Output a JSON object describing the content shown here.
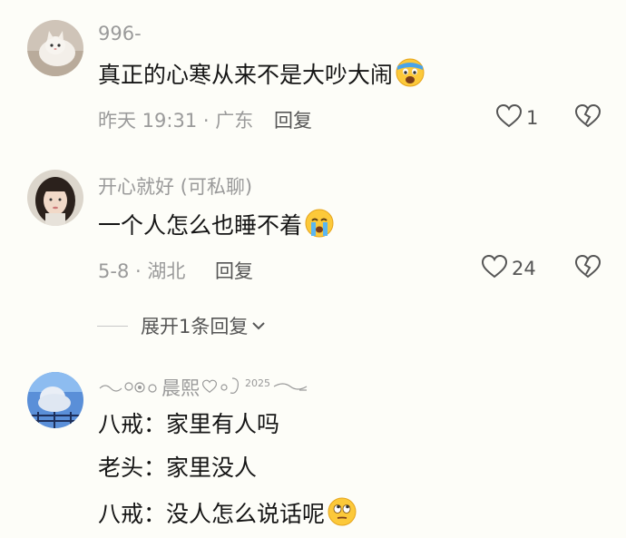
{
  "comments": [
    {
      "username": "996-",
      "text": "真正的心寒从来不是大吵大闹",
      "meta": "昨天 19:31 · 广东",
      "reply_label": "回复",
      "likes": "1",
      "emoji": "worried-face"
    },
    {
      "username": "开心就好 (可私聊)",
      "text": "一个人怎么也睡不着",
      "meta": "5-8 · 湖北",
      "reply_label": "回复",
      "likes": "24",
      "emoji": "crying-face"
    },
    {
      "username": "晨熙",
      "username_year": "2025",
      "lines": [
        "八戒：家里有人吗",
        "老头：家里没人",
        "八戒：没人怎么说话呢"
      ],
      "emoji": "rolling-eyes-face"
    }
  ],
  "expand_replies": {
    "label": "展开1条回复"
  },
  "colors": {
    "background": "#fdfdf8",
    "meta_text": "#9a9a9a",
    "body_text": "#151515"
  }
}
